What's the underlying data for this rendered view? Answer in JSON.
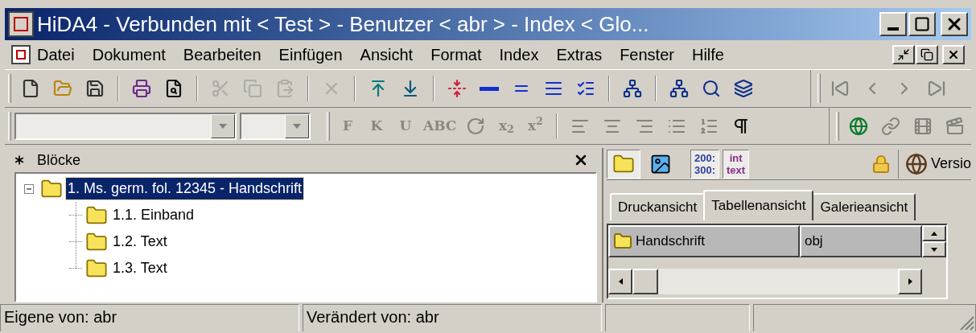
{
  "window": {
    "title": "HiDA4 - Verbunden mit < Test > - Benutzer < abr > - Index < Glo..."
  },
  "menu": [
    "Datei",
    "Dokument",
    "Bearbeiten",
    "Einfügen",
    "Ansicht",
    "Format",
    "Index",
    "Extras",
    "Fenster",
    "Hilfe"
  ],
  "toolbar_main": [
    [
      {
        "kind": "new",
        "disabled": false
      },
      {
        "kind": "open",
        "disabled": false
      },
      {
        "kind": "save",
        "disabled": false
      }
    ],
    [
      {
        "kind": "print",
        "disabled": false
      },
      {
        "kind": "preview",
        "disabled": false
      }
    ],
    [
      {
        "kind": "cut",
        "disabled": true
      },
      {
        "kind": "copy",
        "disabled": true
      },
      {
        "kind": "paste",
        "disabled": true
      }
    ],
    [
      {
        "kind": "delete",
        "disabled": true
      }
    ],
    [
      {
        "kind": "insert-above",
        "disabled": false
      },
      {
        "kind": "insert-below",
        "disabled": false
      }
    ],
    [
      {
        "kind": "split",
        "disabled": false
      },
      {
        "kind": "lines1",
        "disabled": false
      },
      {
        "kind": "lines2",
        "disabled": false
      },
      {
        "kind": "lines3",
        "disabled": false
      },
      {
        "kind": "checklist",
        "disabled": false
      }
    ],
    [
      {
        "kind": "find-block",
        "disabled": false
      }
    ],
    [
      {
        "kind": "tree",
        "disabled": false
      },
      {
        "kind": "search",
        "disabled": false
      },
      {
        "kind": "windows",
        "disabled": false
      }
    ]
  ],
  "toolbar_nav": [
    {
      "kind": "first",
      "disabled": true
    },
    {
      "kind": "prev",
      "disabled": true
    },
    {
      "kind": "next",
      "disabled": true
    },
    {
      "kind": "last",
      "disabled": true
    }
  ],
  "format_bar": [
    [
      {
        "kind": "text",
        "label": "F",
        "disabled": true
      },
      {
        "kind": "text",
        "label": "K",
        "disabled": true
      },
      {
        "kind": "text",
        "label": "U",
        "disabled": true
      },
      {
        "kind": "text",
        "label": "ABC",
        "disabled": true
      },
      {
        "kind": "rotate",
        "disabled": true
      },
      {
        "kind": "text",
        "label": "x$_{2}$",
        "disabled": true
      },
      {
        "kind": "text",
        "label": "x$^{2}$",
        "disabled": true
      }
    ],
    [
      {
        "kind": "align-left",
        "disabled": true
      },
      {
        "kind": "align-center",
        "disabled": true
      },
      {
        "kind": "align-right",
        "disabled": true
      },
      {
        "kind": "bullets",
        "disabled": true
      },
      {
        "kind": "numbers",
        "disabled": true
      },
      {
        "kind": "pilcrow",
        "disabled": false
      }
    ]
  ],
  "extra_bar": [
    {
      "kind": "globe",
      "disabled": false
    },
    {
      "kind": "link",
      "disabled": true
    },
    {
      "kind": "film",
      "disabled": true
    },
    {
      "kind": "film-text",
      "disabled": true
    }
  ],
  "blocks_panel": {
    "title": "Blöcke",
    "tree": [
      {
        "label": "1. Ms. germ. fol. 12345 - Handschrift",
        "expanded": true,
        "selected": true,
        "children": [
          {
            "label": "1.1. Einband",
            "selected": false
          },
          {
            "label": "1.2. Text",
            "selected": false
          },
          {
            "label": "1.3. Text",
            "selected": false
          }
        ]
      }
    ]
  },
  "view_toolbar": [
    {
      "kind": "folders",
      "selected": true
    },
    {
      "kind": "picture",
      "selected": false
    },
    {
      "kind": "text",
      "lines": [
        "200:",
        "300:"
      ],
      "selected": true
    },
    {
      "kind": "text",
      "lines": [
        "int",
        "text"
      ],
      "selected": true
    }
  ],
  "version_button": {
    "label": "Versio"
  },
  "tabs": [
    {
      "label": "Druckansicht",
      "selected": false
    },
    {
      "label": "Tabellenansicht",
      "selected": true
    },
    {
      "label": "Galerieansicht",
      "selected": false
    }
  ],
  "table": {
    "header": [
      {
        "label": "Handschrift",
        "kind": "folder"
      },
      {
        "label": "obj",
        "kind": "plain"
      }
    ]
  },
  "status_bar": [
    "Eigene von: abr",
    "Verändert von: abr"
  ]
}
